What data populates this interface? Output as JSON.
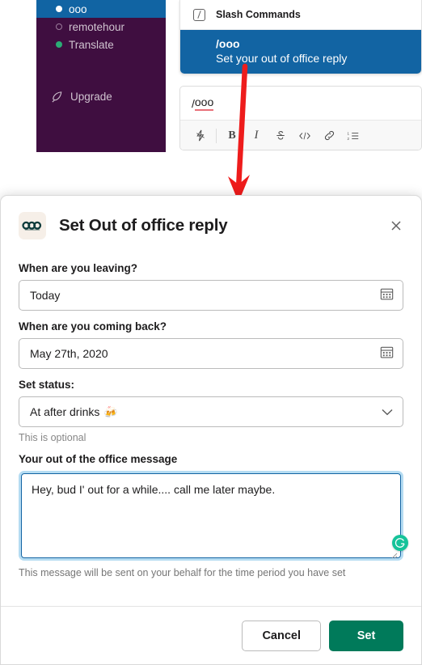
{
  "sidebar": {
    "channels": [
      {
        "name": "ooo",
        "presence": "filled-white",
        "selected": true
      },
      {
        "name": "remotehour",
        "presence": "hollow",
        "selected": false
      },
      {
        "name": "Translate",
        "presence": "green",
        "selected": false
      }
    ],
    "upgrade_label": "Upgrade",
    "bg_color": "#3F0E40",
    "selected_color": "#1164A3"
  },
  "slash_popup": {
    "header": "Slash Commands",
    "command": "/ooo",
    "description": "Set your out of office reply",
    "highlight_color": "#1264A3"
  },
  "composer": {
    "slash": "/",
    "typed_text": "ooo",
    "toolbar": [
      {
        "icon": "lightning-icon",
        "label": "⚡"
      },
      {
        "icon": "bold-icon",
        "label": "B"
      },
      {
        "icon": "italic-icon",
        "label": "I"
      },
      {
        "icon": "strikethrough-icon",
        "label": "S"
      },
      {
        "icon": "code-icon",
        "label": "</>"
      },
      {
        "icon": "link-icon",
        "label": "🔗"
      },
      {
        "icon": "ordered-list-icon",
        "label": "≡"
      }
    ]
  },
  "annotation": {
    "type": "red-arrow",
    "color": "#EE1C1C"
  },
  "modal": {
    "app_icon_name": "ooo-app-icon",
    "title": "Set Out of office reply",
    "close_label": "×",
    "fields": {
      "leaving": {
        "label": "When are you leaving?",
        "value": "Today",
        "icon": "calendar-icon"
      },
      "coming_back": {
        "label": "When are you coming back?",
        "value": "May 27th, 2020",
        "icon": "calendar-icon"
      },
      "status": {
        "label": "Set status:",
        "value": "At after drinks",
        "emoji": "🍻",
        "icon": "chevron-down-icon",
        "hint": "This is optional"
      },
      "message": {
        "label": "Your out of the office message",
        "value": "Hey, bud I' out for a while.... call me later maybe.",
        "footnote": "This message will be sent on your behalf for the time period you have set",
        "assistant_badge": "G"
      }
    },
    "buttons": {
      "cancel": "Cancel",
      "set": "Set"
    },
    "accent_green": "#007A5A"
  }
}
